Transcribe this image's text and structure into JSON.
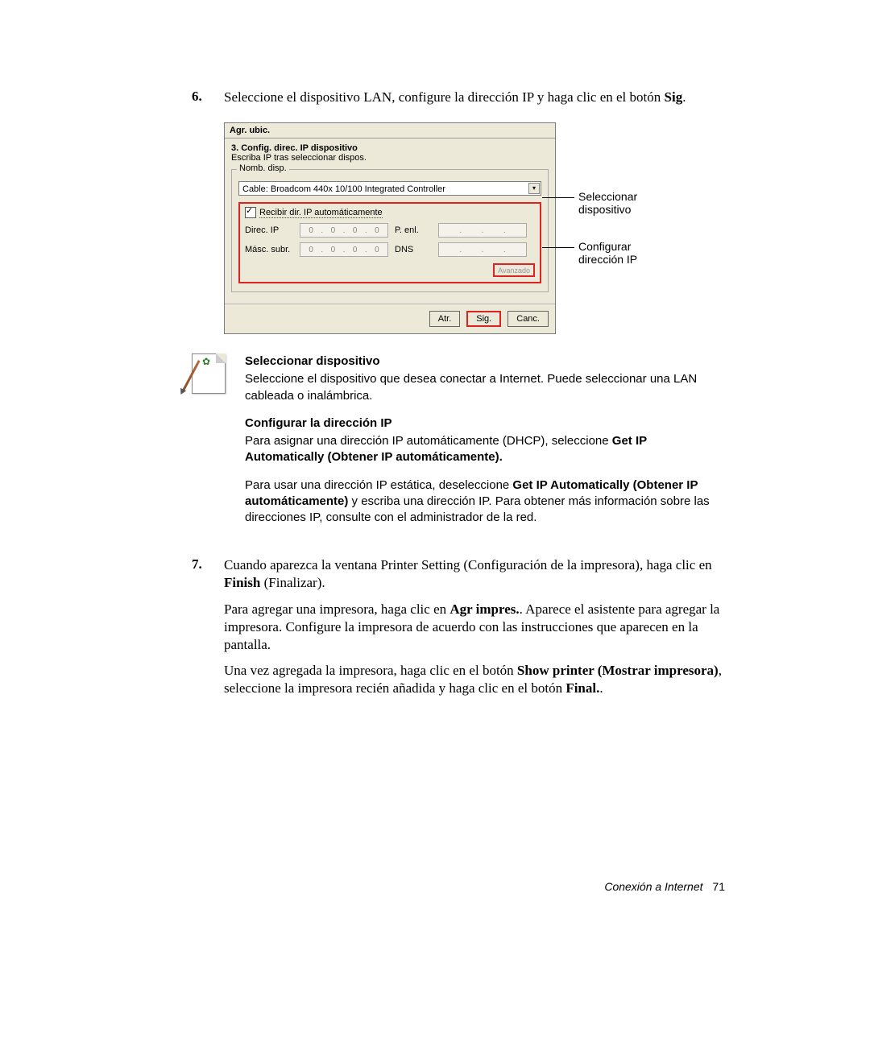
{
  "step6": {
    "num": "6.",
    "text_a": "Seleccione el dispositivo LAN, configure la dirección IP y haga clic en el botón ",
    "text_b": "Sig",
    "text_c": "."
  },
  "dialog": {
    "title": "Agr. ubic.",
    "heading": "3. Config. direc. IP dispositivo",
    "sub": "Escriba IP tras seleccionar dispos.",
    "fieldset_label": "Nomb. disp.",
    "device_value": "Cable: Broadcom 440x 10/100 Integrated Controller",
    "auto_label": "Recibir dir. IP automáticamente",
    "lbl_ip": "Direc. IP",
    "lbl_mask": "Másc. subr.",
    "lbl_gw": "P. enl.",
    "lbl_dns": "DNS",
    "oct": "0",
    "adv": "Avanzado",
    "btn_back": "Atr.",
    "btn_next": "Sig.",
    "btn_cancel": "Canc."
  },
  "callouts": {
    "select_device_l1": "Seleccionar",
    "select_device_l2": "dispositivo",
    "config_ip_l1": "Configurar",
    "config_ip_l2": "dirección IP"
  },
  "note_select": {
    "title": "Seleccionar dispositivo",
    "text": "Seleccione el dispositivo que desea conectar a Internet. Puede seleccionar una LAN cableada o inalámbrica."
  },
  "note_config": {
    "title": "Configurar la dirección IP",
    "p1a": "Para asignar una dirección IP automáticamente (DHCP), seleccione ",
    "p1b": "Get IP Automatically (Obtener IP automáticamente).",
    "p2a": "Para usar una dirección IP estática, deseleccione ",
    "p2b": "Get IP Automatically (Obtener IP automáticamente)",
    "p2c": " y escriba una dirección IP. Para obtener más información sobre las direcciones IP, consulte con el administrador de la red."
  },
  "step7": {
    "num": "7.",
    "p1a": "Cuando aparezca la ventana Printer Setting (Configuración de la impresora), haga clic en ",
    "p1b": "Finish",
    "p1c": " (Finalizar).",
    "p2a": "Para agregar una impresora, haga clic en ",
    "p2b": "Agr impres.",
    "p2c": ". Aparece el asistente para agregar la impresora. Configure la impresora de acuerdo con las instrucciones que aparecen en la pantalla.",
    "p3a": "Una vez agregada la impresora, haga clic en el botón ",
    "p3b": "Show printer (Mostrar impresora)",
    "p3c": ", seleccione la impresora recién añadida y haga clic en el botón ",
    "p3d": "Final.",
    "p3e": "."
  },
  "footer": {
    "section": "Conexión a Internet",
    "page": "71"
  }
}
